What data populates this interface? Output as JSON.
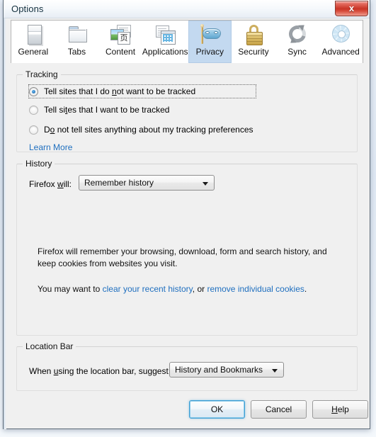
{
  "window": {
    "title": "Options",
    "close_label": "x"
  },
  "tabs": [
    {
      "label": "General",
      "icon": "general-window-icon",
      "selected": false
    },
    {
      "label": "Tabs",
      "icon": "tabs-folder-icon",
      "selected": false
    },
    {
      "label": "Content",
      "icon": "content-page-icon",
      "selected": false
    },
    {
      "label": "Applications",
      "icon": "applications-icon",
      "selected": false
    },
    {
      "label": "Privacy",
      "icon": "privacy-mask-icon",
      "selected": true
    },
    {
      "label": "Security",
      "icon": "security-lock-icon",
      "selected": false
    },
    {
      "label": "Sync",
      "icon": "sync-refresh-icon",
      "selected": false
    },
    {
      "label": "Advanced",
      "icon": "advanced-gear-icon",
      "selected": false
    }
  ],
  "tracking": {
    "legend": "Tracking",
    "options": [
      {
        "label_before": "Tell sites that I do ",
        "accel": "n",
        "label_after": "ot want to be tracked",
        "selected": true,
        "focused": true
      },
      {
        "label_before": "Tell si",
        "accel": "t",
        "label_after": "es that I want to be tracked",
        "selected": false,
        "focused": false
      },
      {
        "label_before": "D",
        "accel": "o",
        "label_after": " not tell sites anything about my tracking preferences",
        "selected": false,
        "focused": false
      }
    ],
    "learn_more": "Learn More"
  },
  "history": {
    "legend": "History",
    "field_label_before": "Firefox ",
    "field_label_accel": "w",
    "field_label_after": "ill:",
    "select_value": "Remember history",
    "description_line1": "Firefox will remember your browsing, download, form and search history, and",
    "description_line2": "keep cookies from websites you visit.",
    "hint_prefix": "You may want to ",
    "hint_link1": "clear your recent history",
    "hint_middle": ", or ",
    "hint_link2": "remove individual cookies",
    "hint_suffix": "."
  },
  "location_bar": {
    "legend": "Location Bar",
    "label_before": "When ",
    "label_accel": "u",
    "label_after": "sing the location bar, suggest:",
    "select_value": "History and Bookmarks"
  },
  "buttons": {
    "ok": "OK",
    "cancel": "Cancel",
    "help_before": "",
    "help_accel": "H",
    "help_after": "elp"
  },
  "colors": {
    "selected_tab": "#c3d9f0",
    "link": "#1f6fbf",
    "dialog_bg": "#f0f0f0",
    "close_button": "#c93426",
    "default_button_focus": "#3f9fd4"
  }
}
